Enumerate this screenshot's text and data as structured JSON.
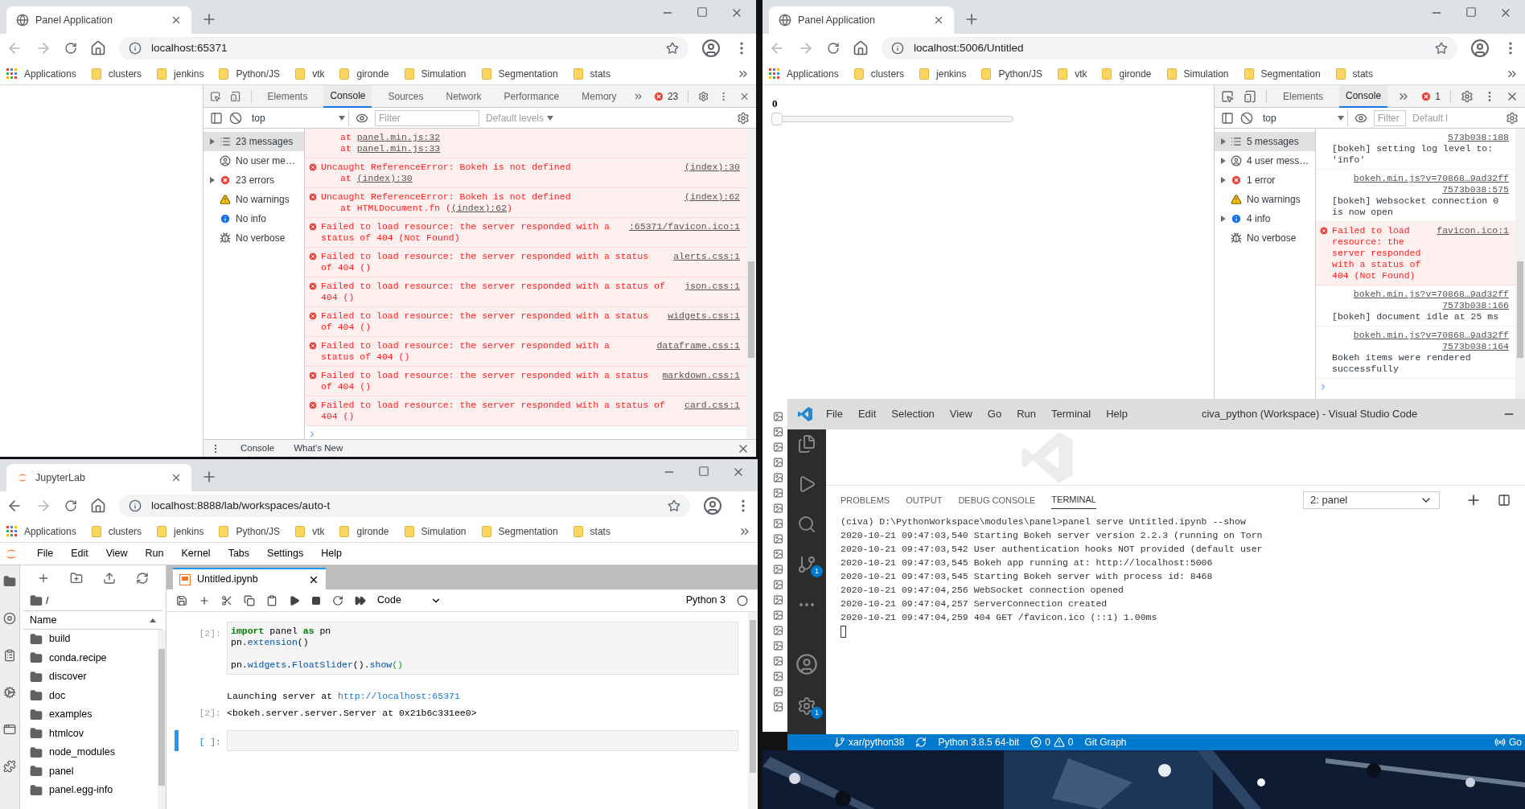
{
  "panel_browser": {
    "tab_title": "Panel Application",
    "kind": "globe",
    "url": "localhost:65371",
    "back_disabled": true,
    "forward_disabled": true,
    "bookmarks": [
      {
        "label": "Applications",
        "kind": "apps"
      },
      {
        "label": "clusters",
        "kind": "folder"
      },
      {
        "label": "jenkins",
        "kind": "folder"
      },
      {
        "label": "Python/JS",
        "kind": "folder"
      },
      {
        "label": "vtk",
        "kind": "folder"
      },
      {
        "label": "gironde",
        "kind": "folder"
      },
      {
        "label": "Simulation",
        "kind": "folder"
      },
      {
        "label": "Segmentation",
        "kind": "folder"
      },
      {
        "label": "stats",
        "kind": "folder"
      }
    ],
    "devtools": {
      "tabs": [
        {
          "label": "Elements",
          "selected": false
        },
        {
          "label": "Console",
          "selected": true
        },
        {
          "label": "Sources",
          "selected": false
        },
        {
          "label": "Network",
          "selected": false
        },
        {
          "label": "Performance",
          "selected": false
        },
        {
          "label": "Memory",
          "selected": false
        }
      ],
      "error_count": "23",
      "context": "top",
      "filter_placeholder": "Filter",
      "levels": "Default levels",
      "sidebar": [
        {
          "label": "23 messages",
          "kind": "messages",
          "expandable": true,
          "selected": true
        },
        {
          "label": "No user me…",
          "kind": "user",
          "expandable": false,
          "selected": false
        },
        {
          "label": "23 errors",
          "kind": "error",
          "expandable": true,
          "selected": false
        },
        {
          "label": "No warnings",
          "kind": "warning",
          "expandable": false,
          "selected": false
        },
        {
          "label": "No info",
          "kind": "info",
          "expandable": false,
          "selected": false
        },
        {
          "label": "No verbose",
          "kind": "verbose",
          "expandable": false,
          "selected": false
        }
      ],
      "messages": [
        {
          "kind": "error",
          "stack": [
            {
              "text": "at ",
              "link": "panel.min.js:32"
            },
            {
              "text": "at ",
              "link": "panel.min.js:33"
            }
          ]
        },
        {
          "kind": "error",
          "text": "Uncaught ReferenceError: Bokeh is not defined",
          "source": "(index):30",
          "stack": [
            {
              "text": "at ",
              "link": "(index):30"
            }
          ]
        },
        {
          "kind": "error",
          "text": "Uncaught ReferenceError: Bokeh is not defined",
          "source": "(index):62",
          "stack": [
            {
              "text": "at HTMLDocument.fn (",
              "link": "(index):62",
              "after": ")"
            }
          ]
        },
        {
          "kind": "error",
          "text": "Failed to load resource: the server responded with a status of 404 (Not Found)",
          "source": ":65371/favicon.ico:1"
        },
        {
          "kind": "error",
          "text": "Failed to load resource: the server responded with a status of 404 ()",
          "source": "alerts.css:1"
        },
        {
          "kind": "error",
          "text": "Failed to load resource: the server responded with a status of 404 ()",
          "source": "json.css:1"
        },
        {
          "kind": "error",
          "text": "Failed to load resource: the server responded with a status of 404 ()",
          "source": "widgets.css:1"
        },
        {
          "kind": "error",
          "text": "Failed to load resource: the server responded with a status of 404 ()",
          "source": "dataframe.css:1"
        },
        {
          "kind": "error",
          "text": "Failed to load resource: the server responded with a status of 404 ()",
          "source": "markdown.css:1"
        },
        {
          "kind": "error",
          "text": "Failed to load resource: the server responded with a status of 404 ()",
          "source": "card.css:1"
        }
      ],
      "drawer_tabs": [
        "Console",
        "What's New"
      ]
    }
  },
  "bokeh_browser": {
    "tab_title": "Panel Application",
    "kind": "globe",
    "url": "localhost:5006/Untitled",
    "back_disabled": true,
    "forward_disabled": true,
    "bookmarks": [
      {
        "label": "Applications",
        "kind": "apps"
      },
      {
        "label": "clusters",
        "kind": "folder"
      },
      {
        "label": "jenkins",
        "kind": "folder"
      },
      {
        "label": "Python/JS",
        "kind": "folder"
      },
      {
        "label": "vtk",
        "kind": "folder"
      },
      {
        "label": "gironde",
        "kind": "folder"
      },
      {
        "label": "Simulation",
        "kind": "folder"
      },
      {
        "label": "Segmentation",
        "kind": "folder"
      },
      {
        "label": "stats",
        "kind": "folder"
      }
    ],
    "slider": {
      "value": "0",
      "level": 0
    },
    "devtools": {
      "tabs": [
        {
          "label": "Elements",
          "selected": false
        },
        {
          "label": "Console",
          "selected": true
        }
      ],
      "error_count": "1",
      "context": "top",
      "filter_placeholder": "Filter",
      "levels": "Default l",
      "sidebar": [
        {
          "label": "5 messages",
          "kind": "messages",
          "expandable": true,
          "selected": true
        },
        {
          "label": "4 user mess…",
          "kind": "user",
          "expandable": true,
          "selected": false
        },
        {
          "label": "1 error",
          "kind": "error",
          "expandable": true,
          "selected": false
        },
        {
          "label": "No warnings",
          "kind": "warning",
          "expandable": false,
          "selected": false
        },
        {
          "label": "4 info",
          "kind": "info",
          "expandable": true,
          "selected": false
        },
        {
          "label": "No verbose",
          "kind": "verbose",
          "expandable": false,
          "selected": false
        }
      ],
      "messages": [
        {
          "kind": "log",
          "source": "573b038:188",
          "text": "[bokeh] setting log level to: 'info'"
        },
        {
          "kind": "log",
          "source": "bokeh.min.js?v=70868…9ad32ff7573b038:575",
          "text": "[bokeh] Websocket connection 0 is now open"
        },
        {
          "kind": "error",
          "source": "favicon.ico:1",
          "text": "Failed to load resource: the server responded with a status of 404 (Not Found)"
        },
        {
          "kind": "log",
          "source": "bokeh.min.js?v=70868…9ad32ff7573b038:166",
          "text": "[bokeh] document idle at 25 ms"
        },
        {
          "kind": "log",
          "source": "bokeh.min.js?v=70868…9ad32ff7573b038:164",
          "text": "Bokeh items were rendered successfully"
        }
      ]
    }
  },
  "jupyter_browser": {
    "tab_title": "JupyterLab",
    "kind": "jupyter",
    "url": "localhost:8888/lab/workspaces/auto-t",
    "back_disabled": false,
    "forward_disabled": true,
    "bookmarks": [
      {
        "label": "Applications",
        "kind": "apps"
      },
      {
        "label": "clusters",
        "kind": "folder"
      },
      {
        "label": "jenkins",
        "kind": "folder"
      },
      {
        "label": "Python/JS",
        "kind": "folder"
      },
      {
        "label": "vtk",
        "kind": "folder"
      },
      {
        "label": "gironde",
        "kind": "folder"
      },
      {
        "label": "Simulation",
        "kind": "folder"
      },
      {
        "label": "Segmentation",
        "kind": "folder"
      },
      {
        "label": "stats",
        "kind": "folder"
      }
    ],
    "menu": [
      "File",
      "Edit",
      "View",
      "Run",
      "Kernel",
      "Tabs",
      "Settings",
      "Help"
    ],
    "file_browser": {
      "path": "/",
      "column": "Name",
      "items": [
        "build",
        "conda.recipe",
        "discover",
        "doc",
        "examples",
        "htmlcov",
        "node_modules",
        "panel",
        "panel.egg-info"
      ]
    },
    "notebook": {
      "tab_title": "Untitled.ipynb",
      "cell_type": "Code",
      "kernel": "Python 3",
      "cells": [
        {
          "prompt": "[2]:",
          "selected": false,
          "code_blocks": [
            [
              [
                {
                  "text": "import",
                  "kind": "keyword"
                },
                {
                  "text": " panel ",
                  "kind": "plain"
                },
                {
                  "text": "as",
                  "kind": "keyword"
                },
                {
                  "text": " pn",
                  "kind": "plain"
                }
              ],
              [
                {
                  "text": "pn.",
                  "kind": "plain"
                },
                {
                  "text": "extension",
                  "kind": "attr"
                },
                {
                  "text": "()",
                  "kind": "plain"
                }
              ]
            ],
            [
              [
                {
                  "text": "pn.",
                  "kind": "plain"
                },
                {
                  "text": "widgets",
                  "kind": "attr"
                },
                {
                  "text": ".",
                  "kind": "plain"
                },
                {
                  "text": "FloatSlider",
                  "kind": "attr"
                },
                {
                  "text": "().",
                  "kind": "plain"
                },
                {
                  "text": "show",
                  "kind": "attr"
                },
                {
                  "text": "()",
                  "kind": "match"
                }
              ]
            ]
          ],
          "stream": {
            "text": "Launching server at ",
            "link": "http://localhost:65371"
          },
          "output": {
            "prompt": "[2]:",
            "text": "<bokeh.server.server.Server at 0x21b6c331ee0>"
          }
        },
        {
          "prompt": "[ ]:",
          "selected": true
        }
      ]
    }
  },
  "vscode": {
    "menu": [
      "File",
      "Edit",
      "Selection",
      "View",
      "Go",
      "Run",
      "Terminal",
      "Help"
    ],
    "title": "civa_python (Workspace) - Visual Studio Code",
    "activity_badges": {
      "source_control": "1",
      "settings": "1"
    },
    "panel_tabs": [
      {
        "label": "PROBLEMS",
        "selected": false
      },
      {
        "label": "OUTPUT",
        "selected": false
      },
      {
        "label": "DEBUG CONSOLE",
        "selected": false
      },
      {
        "label": "TERMINAL",
        "selected": true
      }
    ],
    "terminal_select": "2: panel",
    "terminal_lines": [
      "(civa) D:\\PythonWorkspace\\modules\\panel>panel serve Untitled.ipynb --show",
      "2020-10-21 09:47:03,540 Starting Bokeh server version 2.2.3 (running on Torn",
      "2020-10-21 09:47:03,542 User authentication hooks NOT provided (default user",
      "2020-10-21 09:47:03,545 Bokeh app running at: http://localhost:5006",
      "2020-10-21 09:47:03,545 Starting Bokeh server with process id: 8468",
      "2020-10-21 09:47:04,256 WebSocket connection opened",
      "2020-10-21 09:47:04,257 ServerConnection created",
      "2020-10-21 09:47:04,259 404 GET /favicon.ico (::1) 1.00ms"
    ],
    "status": {
      "branch": "xar/python38",
      "python": "Python 3.8.5 64-bit",
      "errors": "0",
      "warnings": "0",
      "git_graph": "Git Graph",
      "live_share": "Go"
    }
  }
}
